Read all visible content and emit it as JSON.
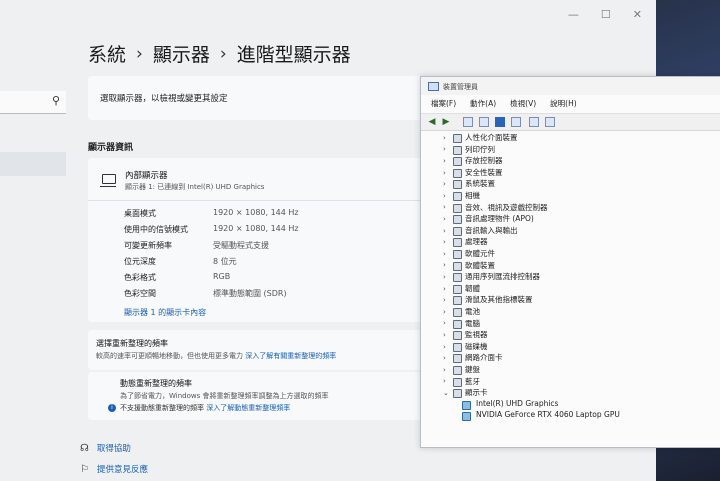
{
  "settings": {
    "window_controls": [
      "—",
      "☐",
      "✕"
    ],
    "breadcrumb": [
      "系統",
      "顯示器",
      "進階型顯示器"
    ],
    "breadcrumb_sep": "›",
    "select_display_text": "選取顯示器，以檢視或變更其設定",
    "section_title": "顯示器資訊",
    "display": {
      "name": "內部顯示器",
      "subtitle": "顯示器 1: 已連線到 Intel(R) UHD Graphics"
    },
    "rows": [
      {
        "label": "桌面模式",
        "value": "1920 × 1080, 144 Hz"
      },
      {
        "label": "使用中的信號模式",
        "value": "1920 × 1080, 144 Hz"
      },
      {
        "label": "可變更新頻率",
        "value": "受驅動程式支援"
      },
      {
        "label": "位元深度",
        "value": "8 位元"
      },
      {
        "label": "色彩格式",
        "value": "RGB"
      },
      {
        "label": "色彩空間",
        "value": "標準動態範圍 (SDR)"
      }
    ],
    "adapter_link": "顯示器 1 的顯示卡內容",
    "refresh": {
      "title": "選擇重新整理的頻率",
      "desc": "較高的速率可更順暢地移動，但也使用更多電力",
      "link": "深入了解有關重新整理的頻率"
    },
    "dynamic": {
      "title": "動態重新整理的頻率",
      "desc": "為了節省電力，Windows 會將重新整理頻率調整為上方選取的頻率",
      "note": "不支援動態重新整理的頻率",
      "link": "深入了解動態重新整理頻率"
    },
    "help": [
      {
        "label": "取得協助"
      },
      {
        "label": "提供意見反應"
      }
    ]
  },
  "devmgr": {
    "title": "裝置管理員",
    "menu": [
      "檔案(F)",
      "動作(A)",
      "檢視(V)",
      "說明(H)"
    ],
    "tree": [
      {
        "label": "人性化介面裝置",
        "expanded": false
      },
      {
        "label": "列印佇列",
        "expanded": false
      },
      {
        "label": "存放控制器",
        "expanded": false
      },
      {
        "label": "安全性裝置",
        "expanded": false
      },
      {
        "label": "系統裝置",
        "expanded": false
      },
      {
        "label": "相機",
        "expanded": false
      },
      {
        "label": "音效、視訊及遊戲控制器",
        "expanded": false
      },
      {
        "label": "音訊處理物件 (APO)",
        "expanded": false
      },
      {
        "label": "音訊輸入與輸出",
        "expanded": false
      },
      {
        "label": "處理器",
        "expanded": false
      },
      {
        "label": "軟體元件",
        "expanded": false
      },
      {
        "label": "軟體裝置",
        "expanded": false
      },
      {
        "label": "通用序列匯流排控制器",
        "expanded": false
      },
      {
        "label": "韌體",
        "expanded": false
      },
      {
        "label": "滑鼠及其他指標裝置",
        "expanded": false
      },
      {
        "label": "電池",
        "expanded": false
      },
      {
        "label": "電腦",
        "expanded": false
      },
      {
        "label": "監視器",
        "expanded": false
      },
      {
        "label": "磁碟機",
        "expanded": false
      },
      {
        "label": "網路介面卡",
        "expanded": false
      },
      {
        "label": "鍵盤",
        "expanded": false
      },
      {
        "label": "藍牙",
        "expanded": false
      },
      {
        "label": "顯示卡",
        "expanded": true,
        "children": [
          "Intel(R) UHD Graphics",
          "NVIDIA GeForce RTX 4060 Laptop GPU"
        ]
      }
    ],
    "chevron_collapsed": "›",
    "chevron_expanded": "⌄"
  }
}
